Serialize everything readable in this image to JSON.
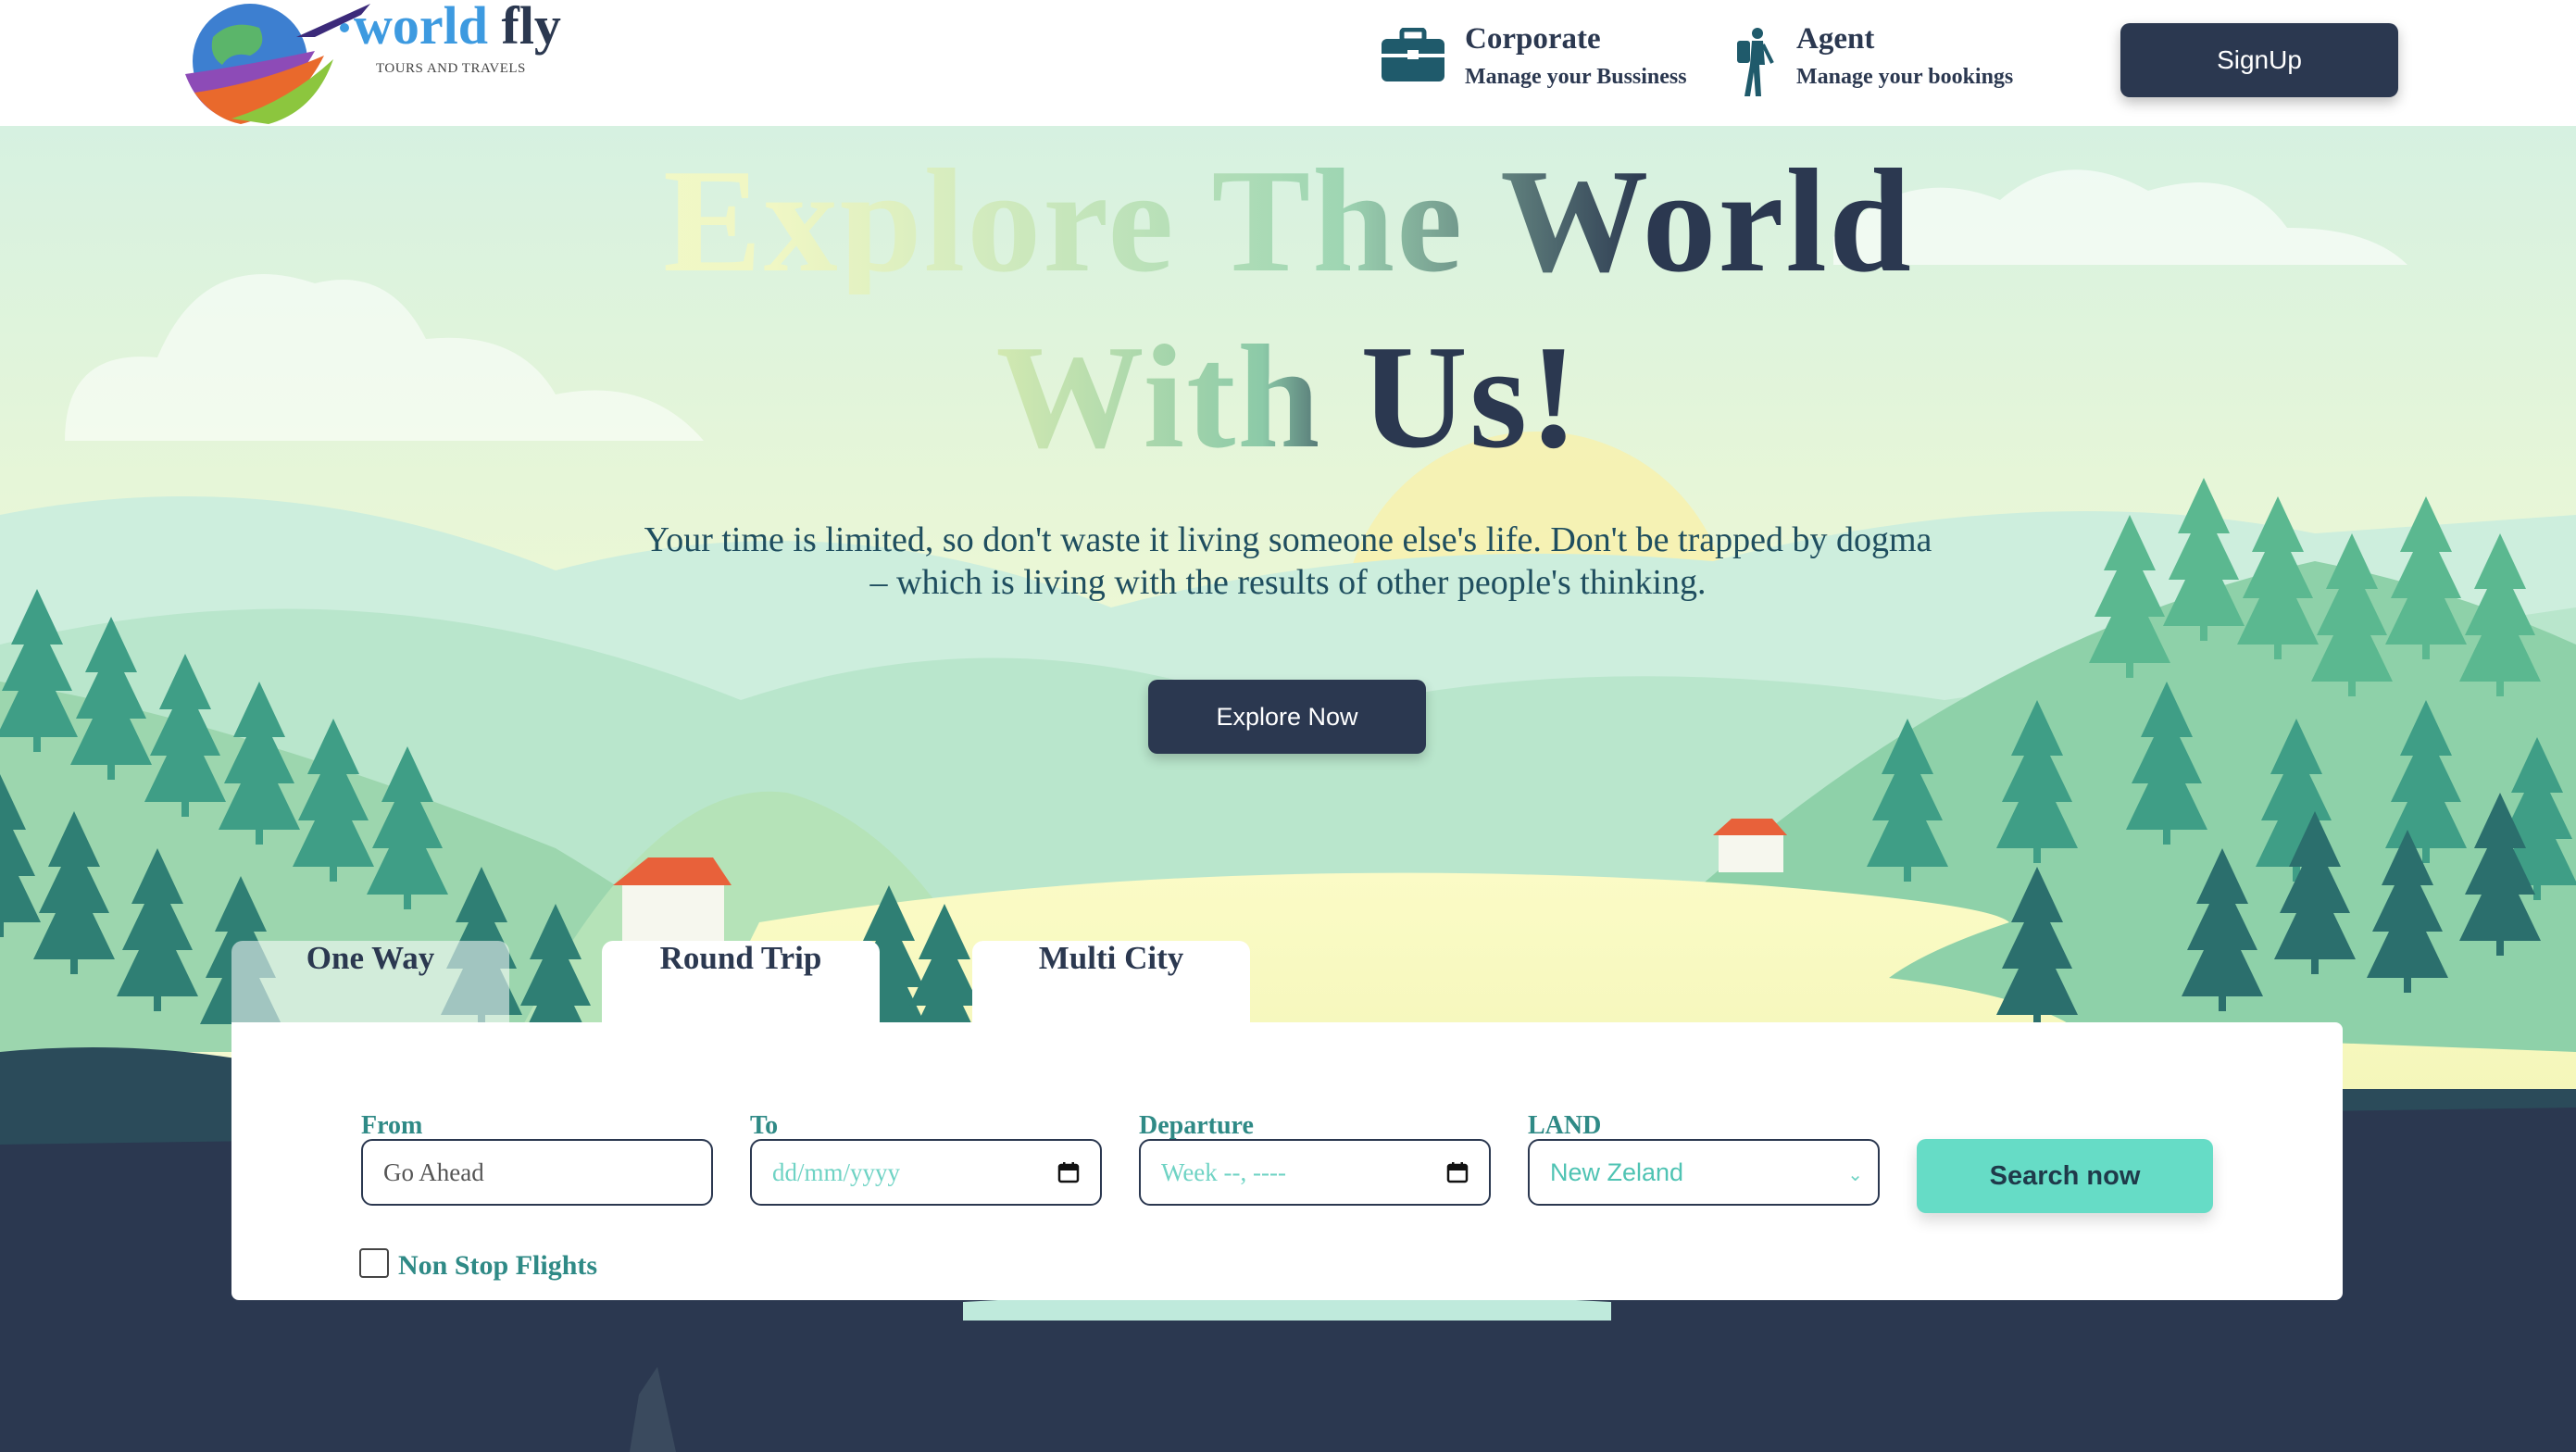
{
  "header": {
    "brand_part1": "world",
    "brand_part2": "fly",
    "tagline": "TOURS AND TRAVELS",
    "nav": [
      {
        "title": "Corporate",
        "subtitle": "Manage your Bussiness",
        "icon": "briefcase-icon"
      },
      {
        "title": "Agent",
        "subtitle": "Manage your bookings",
        "icon": "traveler-icon"
      }
    ],
    "signup_label": "SignUp"
  },
  "hero": {
    "headline_line1": "Explore The World",
    "headline_line2": "With Us!",
    "quote": "Your time is limited, so don't waste it living someone else's life. Don't be trapped by dogma – which is living with the results of other people's thinking.",
    "cta_label": "Explore Now"
  },
  "booking": {
    "tabs": [
      "One Way",
      "Round Trip",
      "Multi City"
    ],
    "fields": {
      "from": {
        "label": "From",
        "value": "Go Ahead"
      },
      "to": {
        "label": "To",
        "placeholder": "dd/mm/yyyy"
      },
      "departure": {
        "label": "Departure",
        "placeholder": "Week --, ----"
      },
      "land": {
        "label": "LAND",
        "value": "New Zeland"
      }
    },
    "search_label": "Search now",
    "nonstop_label": "Non Stop Flights"
  },
  "colors": {
    "navy": "#2b3850",
    "teal_text": "#2f8a86",
    "search_button": "#66dcc6",
    "brand_blue": "#3d9ae0"
  }
}
